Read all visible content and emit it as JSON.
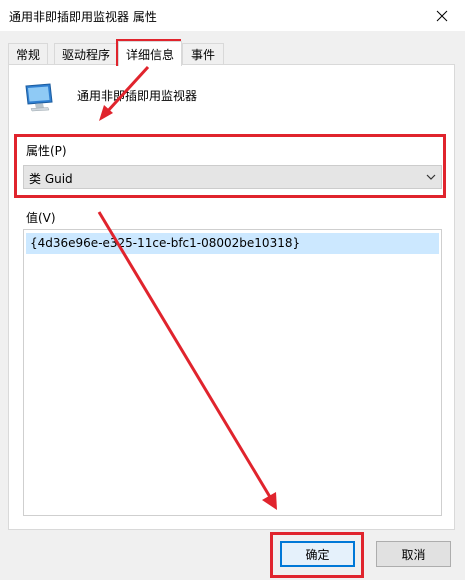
{
  "window": {
    "title": "通用非即插即用监视器 属性",
    "close_icon": "close-icon"
  },
  "tabs": [
    {
      "label": "常规",
      "active": false
    },
    {
      "label": "驱动程序",
      "active": false
    },
    {
      "label": "详细信息",
      "active": true
    },
    {
      "label": "事件",
      "active": false
    }
  ],
  "device": {
    "icon": "monitor-icon",
    "name": "通用非即插即用监视器"
  },
  "property": {
    "label": "属性(P)",
    "selected": "类 Guid"
  },
  "value": {
    "label": "值(V)",
    "items": [
      "{4d36e96e-e325-11ce-bfc1-08002be10318}"
    ]
  },
  "buttons": {
    "ok": "确定",
    "cancel": "取消"
  },
  "colors": {
    "annotation": "#e0242d",
    "selection": "#cce8ff",
    "focus_border": "#0078d7"
  }
}
